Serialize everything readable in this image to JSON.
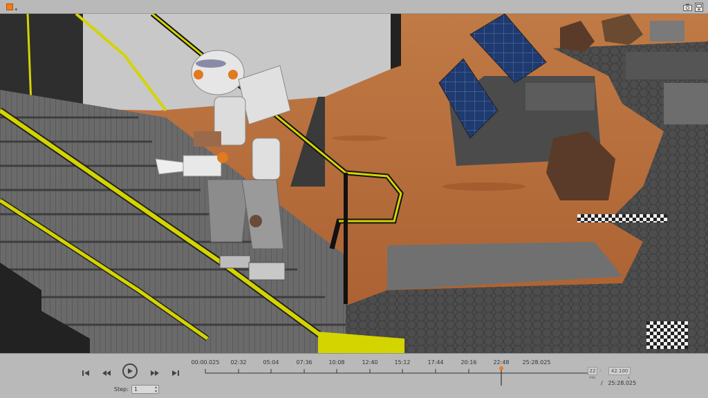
{
  "toolbar": {
    "view_angle_icon": "view-angle-icon",
    "screenshot_icon": "camera-icon",
    "record_icon": "video-record-icon"
  },
  "playback": {
    "jump_start_icon": "skip-to-start-icon",
    "step_back_icon": "step-back-icon",
    "play_icon": "play-icon",
    "step_forward_icon": "step-forward-icon",
    "jump_end_icon": "skip-to-end-icon",
    "step_label": "Step:",
    "step_value": "1"
  },
  "timeline": {
    "tick_labels": [
      "00:00.025",
      "02:32",
      "05:04",
      "07:36",
      "10:08",
      "12:40",
      "15:12",
      "17:44",
      "20:16",
      "22:48",
      "25:28.025"
    ],
    "marker_color": "#f07c1e",
    "current_fraction": 0.919
  },
  "sim_time": {
    "minutes": "22",
    "minutes_unit": "min",
    "seconds": "42.100",
    "seconds_unit": "s",
    "total_prefix": "/",
    "total": "25:28.025"
  },
  "colors": {
    "accent": "#f07c1e",
    "rail": "#d4d400",
    "mars_ground": "#b8693a",
    "panel": "#b9b9b9"
  }
}
